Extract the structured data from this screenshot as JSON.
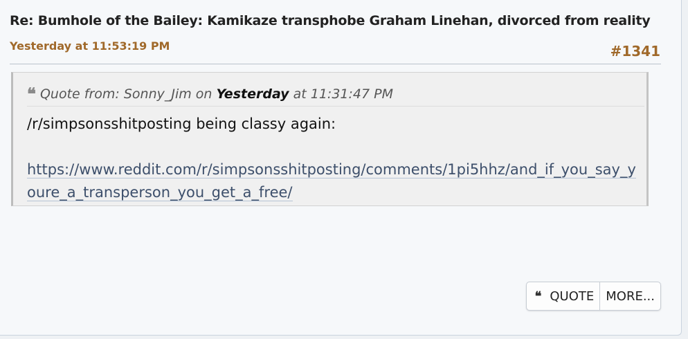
{
  "post": {
    "title": "Re: Bumhole of the Bailey: Kamikaze transphobe Graham Linehan, divorced from reality",
    "timestamp": "Yesterday at 11:53:19 PM",
    "number": "#1341"
  },
  "quote": {
    "icon": "quote-icon",
    "prefix": "Quote from: ",
    "author": "Sonny_Jim",
    "on_text": " on ",
    "date_bold": "Yesterday",
    "time_text": " at 11:31:47 PM",
    "text": "/r/simpsonsshitposting being classy again:",
    "link": "https://www.reddit.com/r/simpsonsshitposting/comments/1pi5hhz/and_if_you_say_youre_a_transperson_you_get_a_free/"
  },
  "actions": {
    "quote_icon": "❝",
    "quote_label": "QUOTE",
    "more_label": "MORE..."
  },
  "colors": {
    "accent": "#a0692a",
    "link": "#3d4f6b",
    "background": "#f6f8fa"
  }
}
